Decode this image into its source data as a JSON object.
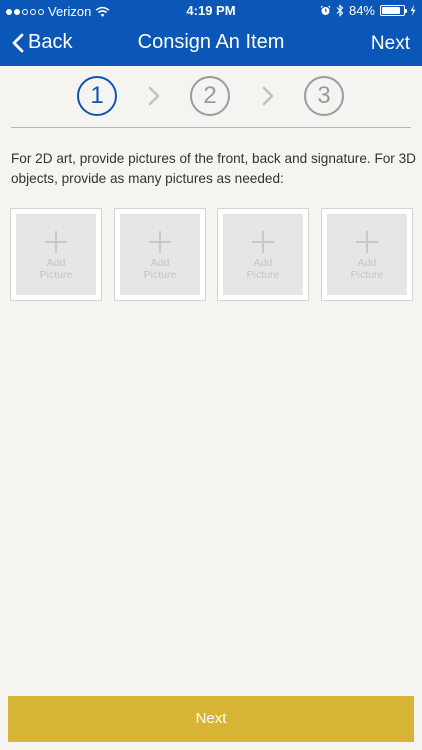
{
  "status_bar": {
    "carrier": "Verizon",
    "time": "4:19 PM",
    "battery_percent": "84%",
    "battery_level": 0.84,
    "signal_bars_filled": 2,
    "signal_bars_total": 5
  },
  "nav": {
    "back_label": "Back",
    "title": "Consign An Item",
    "next_label": "Next"
  },
  "stepper": {
    "steps": [
      "1",
      "2",
      "3"
    ],
    "active_step": 1
  },
  "instructions": "For 2D art, provide pictures of the front, back and signature. For 3D objects, provide as many pictures as needed:",
  "photo_tiles": [
    {
      "label": "Add\nPicture"
    },
    {
      "label": "Add\nPicture"
    },
    {
      "label": "Add\nPicture"
    },
    {
      "label": "Add\nPicture"
    }
  ],
  "bottom_button_label": "Next",
  "colors": {
    "brand_blue": "#0b57b8",
    "button_gold": "#d8b436",
    "inactive_gray": "#9b9b9b"
  }
}
